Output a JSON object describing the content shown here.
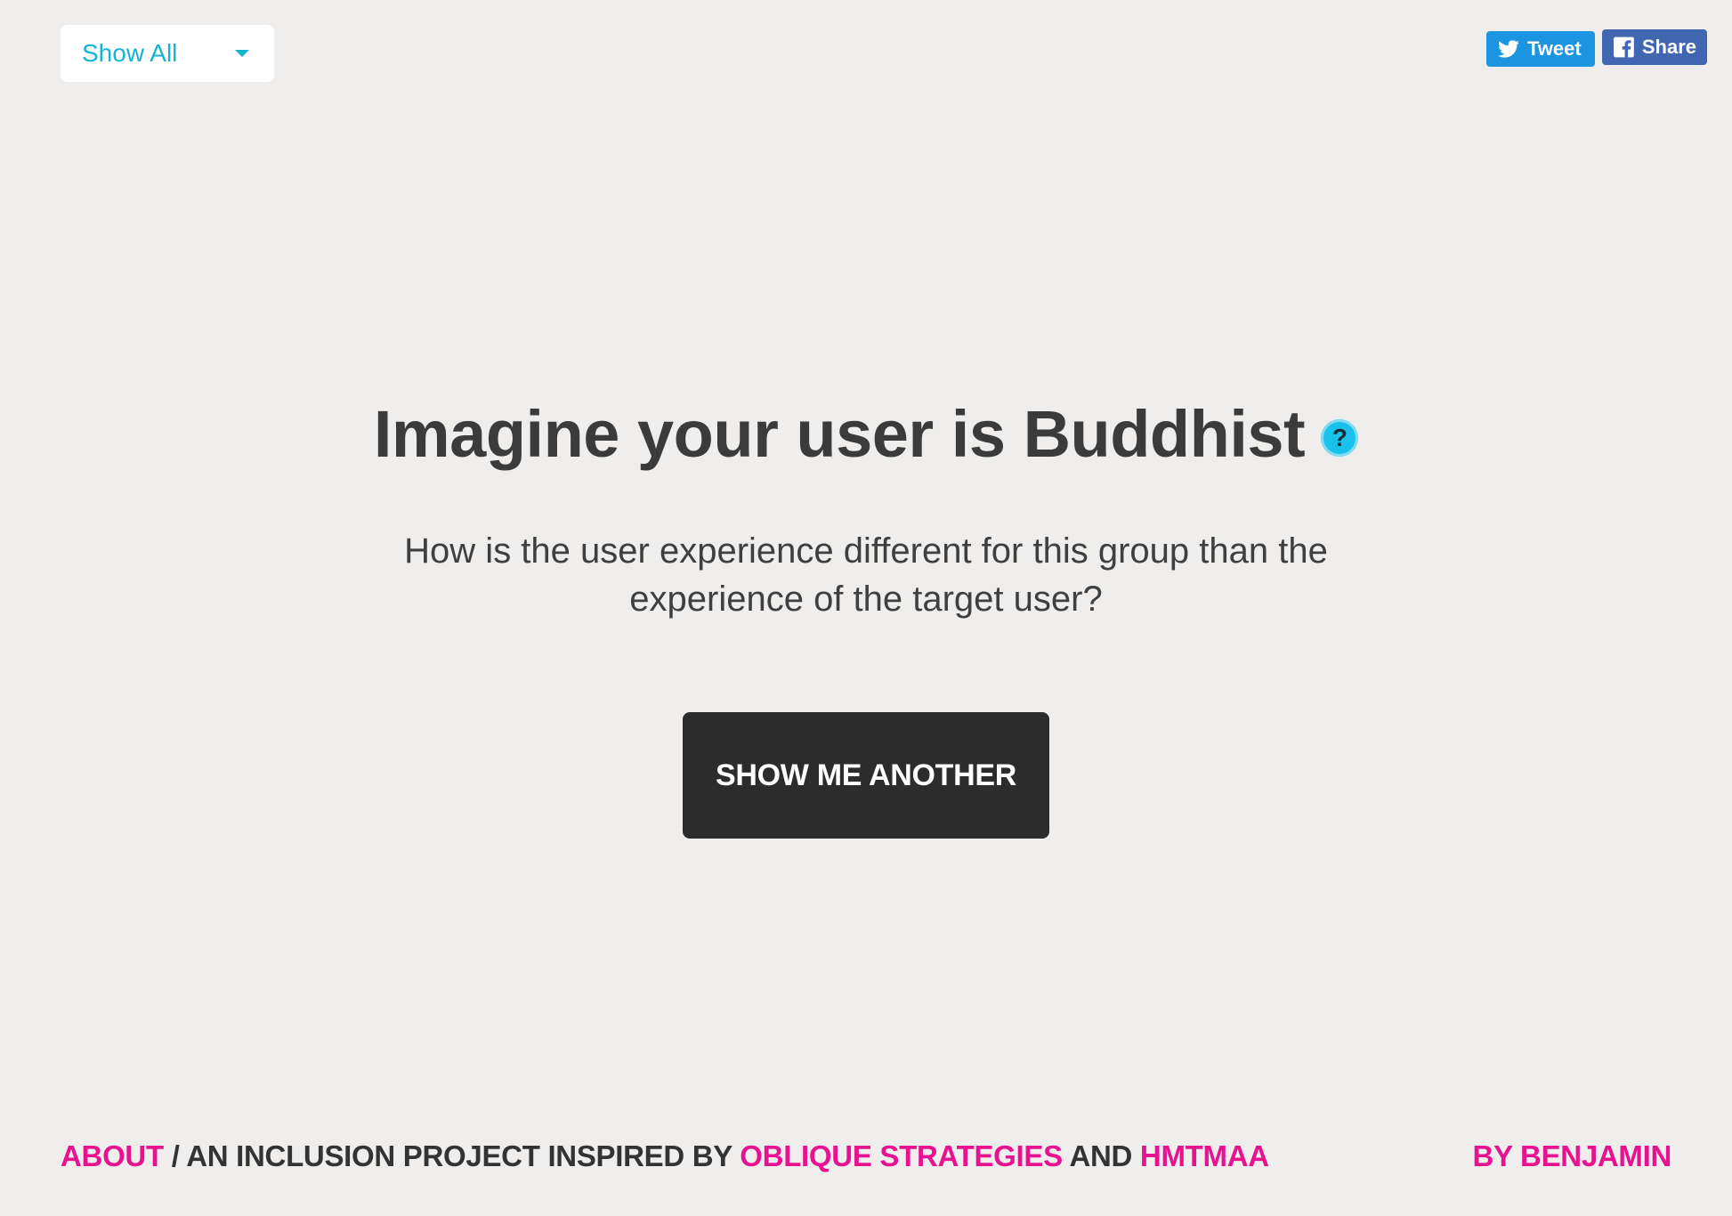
{
  "filter": {
    "selected": "Show All",
    "icon": "caret-down-icon"
  },
  "social": {
    "tweet_label": "Tweet",
    "share_label": "Share",
    "tweet_icon": "twitter-bird-icon",
    "share_icon": "facebook-icon"
  },
  "card": {
    "title": "Imagine your user is Buddhist",
    "help_icon_text": "?",
    "question": "How is the user experience different for this group than the experience of the target user?"
  },
  "button": {
    "label": "SHOW ME ANOTHER"
  },
  "footer": {
    "about_link": "ABOUT",
    "text_1": " / AN INCLUSION PROJECT INSPIRED BY ",
    "oblique_link": "OBLIQUE STRATEGIES",
    "text_2": " AND ",
    "hmtmaa_link": "HMTMAA",
    "author_link": "BY BENJAMIN"
  },
  "colors": {
    "background": "#efeeec",
    "accent_cyan": "#14b4d2",
    "link_magenta": "#e6128f",
    "button_dark": "#2c2c2c",
    "twitter_blue": "#1b95e0",
    "facebook_blue": "#4267b2"
  }
}
